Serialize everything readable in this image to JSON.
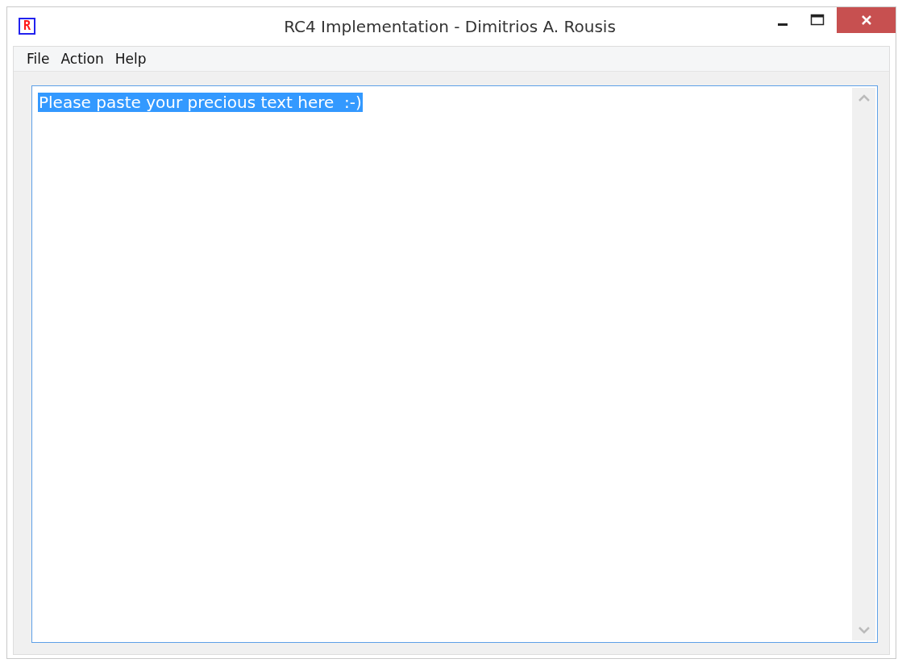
{
  "window": {
    "title": "RC4 Implementation - Dimitrios A. Rousis",
    "logo": "R"
  },
  "menu": [
    {
      "label": "File"
    },
    {
      "label": "Action"
    },
    {
      "label": "Help"
    }
  ],
  "editor": {
    "value": "Please paste your precious text here  :-)",
    "selected": true
  }
}
